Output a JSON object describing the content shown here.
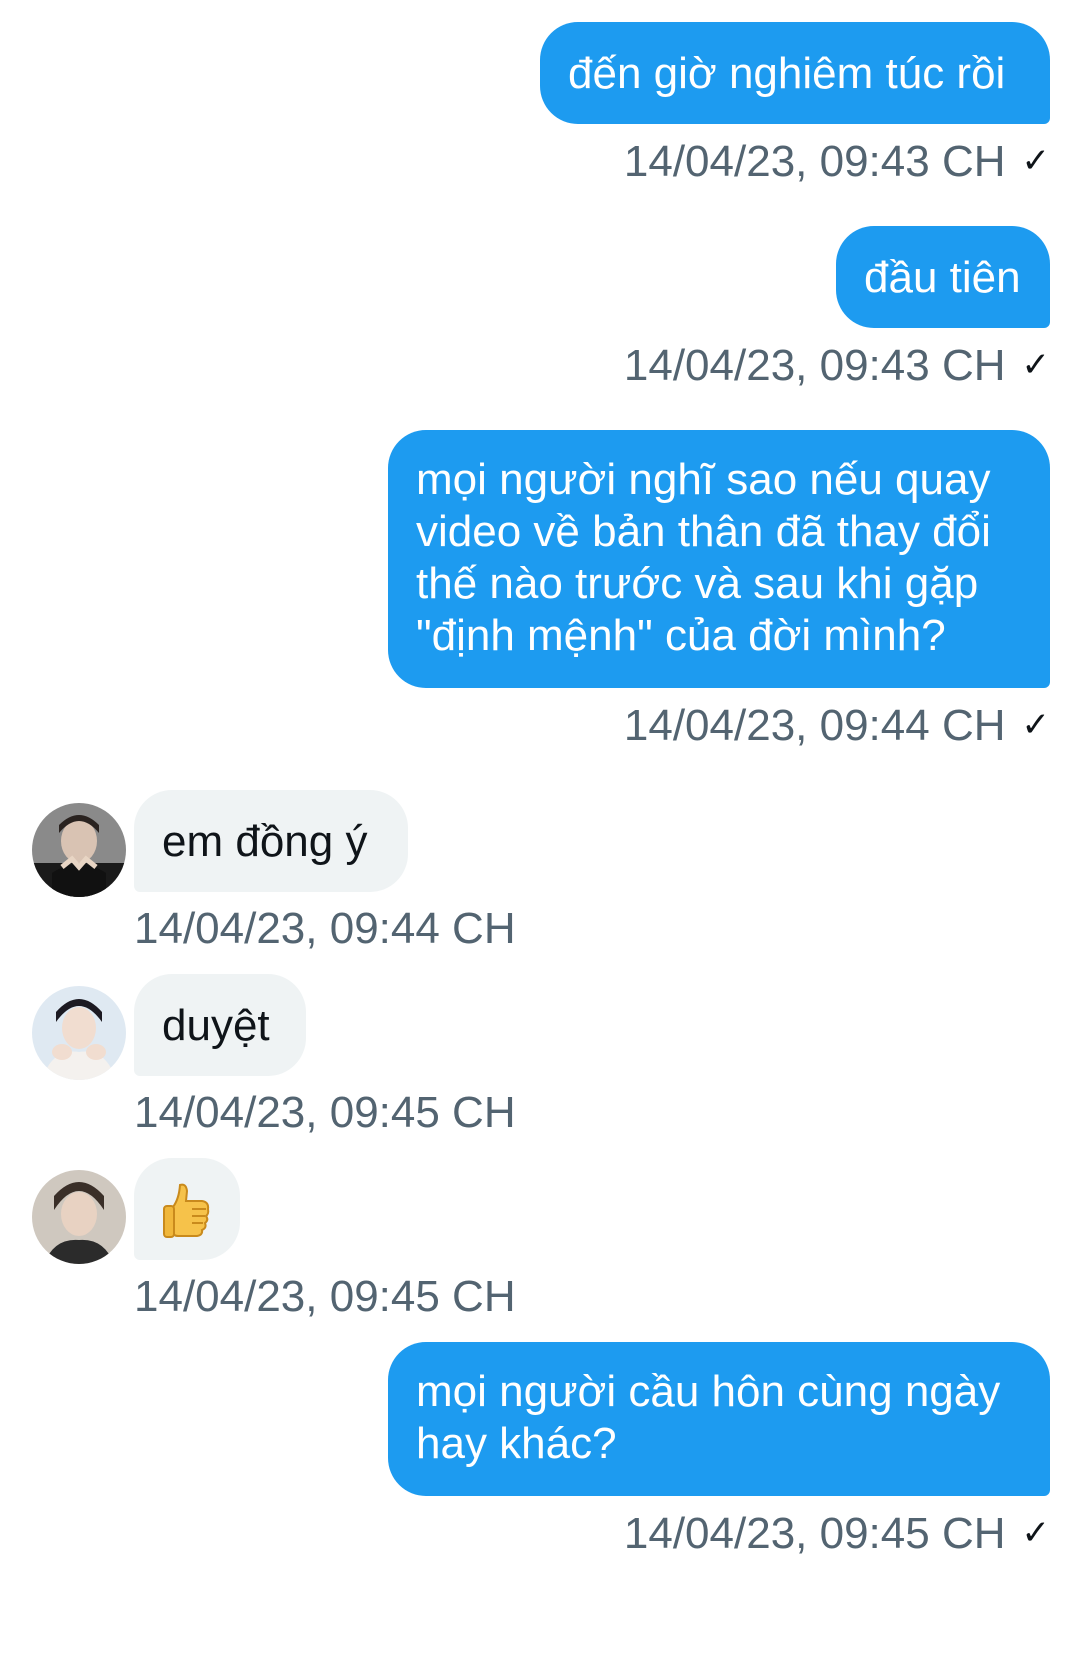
{
  "messages": [
    {
      "id": "m1",
      "direction": "outgoing",
      "lines": [
        "đến giờ nghiêm túc rồi"
      ],
      "time": "14/04/23, 09:43 CH",
      "receipt": "✓"
    },
    {
      "id": "m2",
      "direction": "outgoing",
      "lines": [
        "đầu tiên"
      ],
      "time": "14/04/23, 09:43 CH",
      "receipt": "✓"
    },
    {
      "id": "m3",
      "direction": "outgoing",
      "lines": [
        "mọi người nghĩ sao nếu quay",
        "video về bản thân đã thay đổi",
        "thế nào trước và sau khi gặp",
        "\"định mệnh\" của đời mình?"
      ],
      "time": "14/04/23, 09:44 CH",
      "receipt": "✓"
    },
    {
      "id": "m4",
      "direction": "incoming",
      "lines": [
        "em đồng ý"
      ],
      "time": "14/04/23, 09:44 CH",
      "avatar": "avatar-user-1"
    },
    {
      "id": "m5",
      "direction": "incoming",
      "lines": [
        "duyệt"
      ],
      "time": "14/04/23, 09:45 CH",
      "avatar": "avatar-user-2"
    },
    {
      "id": "m6",
      "direction": "incoming",
      "emoji": "thumbs-up-icon",
      "time": "14/04/23, 09:45 CH",
      "avatar": "avatar-user-3"
    },
    {
      "id": "m7",
      "direction": "outgoing",
      "lines": [
        "mọi người cầu hôn cùng ngày",
        "hay khác?"
      ],
      "time": "14/04/23, 09:45 CH",
      "receipt": "✓"
    }
  ],
  "colors": {
    "outgoing_bubble": "#1d9bf0",
    "incoming_bubble": "#eff3f4",
    "timestamp": "#536471"
  }
}
